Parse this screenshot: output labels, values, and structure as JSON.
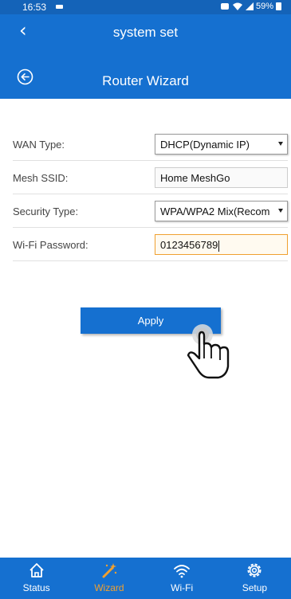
{
  "status_bar": {
    "time": "16:53",
    "battery": "59%"
  },
  "header": {
    "title": "system set",
    "back_icon": "chevron-left-icon"
  },
  "sub_header": {
    "title": "Router Wizard",
    "back_icon": "circle-arrow-left-icon"
  },
  "form": {
    "wan_type": {
      "label": "WAN Type:",
      "value": "DHCP(Dynamic IP)"
    },
    "mesh_ssid": {
      "label": "Mesh SSID:",
      "value": "Home MeshGo"
    },
    "security_type": {
      "label": "Security Type:",
      "value": "WPA/WPA2 Mix(Recom"
    },
    "wifi_password": {
      "label": "Wi-Fi Password:",
      "value": "0123456789"
    }
  },
  "apply_label": "Apply",
  "tabbar": {
    "items": [
      {
        "label": "Status",
        "icon": "home-icon"
      },
      {
        "label": "Wizard",
        "icon": "wand-icon",
        "active": true
      },
      {
        "label": "Wi-Fi",
        "icon": "wifi-icon"
      },
      {
        "label": "Setup",
        "icon": "gear-icon"
      }
    ]
  },
  "colors": {
    "primary": "#1570d0",
    "status_bar": "#1463b8",
    "active_tab": "#f0a030",
    "focus_border": "#f0a030"
  }
}
